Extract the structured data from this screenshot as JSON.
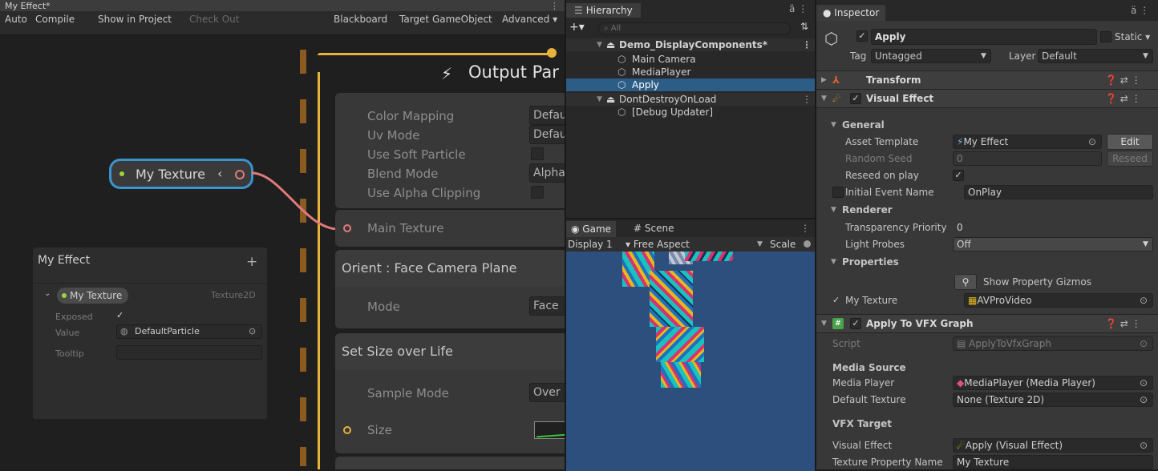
{
  "vfx": {
    "tab_title": "My Effect*",
    "toolbar": {
      "auto": "Auto",
      "compile": "Compile",
      "show_in_project": "Show in Project",
      "check_out": "Check Out",
      "blackboard": "Blackboard",
      "target": "Target GameObject",
      "advanced": "Advanced ▾"
    },
    "property_node": "My Texture",
    "output_title": "Output Par",
    "output_rows": [
      {
        "label": "Color Mapping",
        "value": "Defau"
      },
      {
        "label": "Uv Mode",
        "value": "Defau"
      },
      {
        "label": "Use Soft Particle",
        "value": ""
      },
      {
        "label": "Blend Mode",
        "value": "Alpha"
      },
      {
        "label": "Use Alpha Clipping",
        "value": ""
      }
    ],
    "main_texture": "Main Texture",
    "orient_title": "Orient : Face Camera Plane",
    "orient_mode_label": "Mode",
    "orient_mode_value": "Face",
    "size_title": "Set Size over Life",
    "sample_mode_label": "Sample Mode",
    "sample_mode_value": "Over",
    "size_label": "Size",
    "blackboard": {
      "title": "My Effect",
      "add": "+",
      "prop_name": "My Texture",
      "prop_type": "Texture2D",
      "exposed_label": "Exposed",
      "value_label": "Value",
      "value": "DefaultParticle",
      "tooltip_label": "Tooltip"
    }
  },
  "hierarchy": {
    "tab": "Hierarchy",
    "search_placeholder": "All",
    "items": [
      {
        "label": "Demo_DisplayComponents*"
      },
      {
        "label": "Main Camera"
      },
      {
        "label": "MediaPlayer"
      },
      {
        "label": "Apply"
      },
      {
        "label": "DontDestroyOnLoad"
      },
      {
        "label": "[Debug Updater]"
      }
    ]
  },
  "game": {
    "tab_game": "Game",
    "tab_scene": "Scene",
    "display": "Display 1",
    "aspect": "Free Aspect",
    "scale": "Scale"
  },
  "inspector": {
    "tab": "Inspector",
    "object_name": "Apply",
    "static": "Static",
    "tag_label": "Tag",
    "tag_value": "Untagged",
    "layer_label": "Layer",
    "layer_value": "Default",
    "transform": "Transform",
    "visual_effect": "Visual Effect",
    "general": "General",
    "asset_template_label": "Asset Template",
    "asset_template_value": "My Effect",
    "edit": "Edit",
    "random_seed_label": "Random Seed",
    "random_seed_value": "0",
    "reseed": "Reseed",
    "reseed_on_play": "Reseed on play",
    "initial_event_label": "Initial Event Name",
    "initial_event_value": "OnPlay",
    "renderer": "Renderer",
    "transparency_label": "Transparency Priority",
    "transparency_value": "0",
    "light_probes_label": "Light Probes",
    "light_probes_value": "Off",
    "properties": "Properties",
    "show_gizmos": "Show Property Gizmos",
    "my_texture_label": "My Texture",
    "my_texture_value": "AVProVideo",
    "apply_to_vfx": "Apply To VFX Graph",
    "script_label": "Script",
    "script_value": "ApplyToVfxGraph",
    "media_source": "Media Source",
    "media_player_label": "Media Player",
    "media_player_value": "MediaPlayer (Media Player)",
    "default_texture_label": "Default Texture",
    "default_texture_value": "None (Texture 2D)",
    "vfx_target": "VFX Target",
    "visual_effect_label": "Visual Effect",
    "visual_effect_value": "Apply (Visual Effect)",
    "texture_prop_label": "Texture Property Name",
    "texture_prop_value": "My Texture"
  }
}
